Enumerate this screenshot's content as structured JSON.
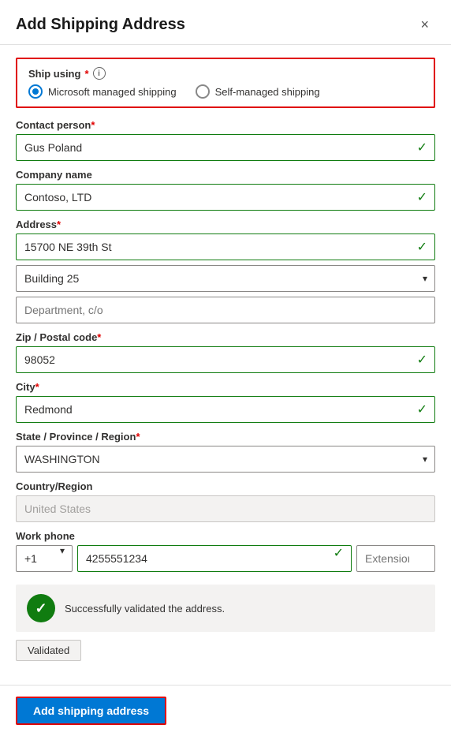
{
  "modal": {
    "title": "Add Shipping Address",
    "close_label": "×"
  },
  "ship_using": {
    "label": "Ship using",
    "required": "*",
    "info": "i",
    "options": [
      {
        "id": "microsoft",
        "label": "Microsoft managed shipping",
        "selected": true
      },
      {
        "id": "self",
        "label": "Self-managed shipping",
        "selected": false
      }
    ]
  },
  "fields": {
    "contact_person": {
      "label": "Contact person",
      "required": "*",
      "value": "Gus Poland",
      "validated": true
    },
    "company_name": {
      "label": "Company name",
      "required": "",
      "value": "Contoso, LTD",
      "validated": true
    },
    "address": {
      "label": "Address",
      "required": "*",
      "line1": {
        "value": "15700 NE 39th St",
        "validated": true
      },
      "line2": {
        "value": "Building 25",
        "validated": false
      },
      "line3": {
        "placeholder": "Department, c/o",
        "value": "",
        "validated": false
      }
    },
    "zip": {
      "label": "Zip / Postal code",
      "required": "*",
      "value": "98052",
      "validated": true
    },
    "city": {
      "label": "City",
      "required": "*",
      "value": "Redmond",
      "validated": true
    },
    "state": {
      "label": "State / Province / Region",
      "required": "*",
      "value": "WASHINGTON",
      "validated": false
    },
    "country": {
      "label": "Country/Region",
      "required": "",
      "value": "United States",
      "disabled": true
    },
    "phone": {
      "label": "Work phone",
      "required": "",
      "code": "+1",
      "number": "4255551234",
      "extension_placeholder": "Extension",
      "validated": true
    }
  },
  "success": {
    "message": "Successfully validated the address.",
    "check": "✓"
  },
  "validated_button": "Validated",
  "footer": {
    "add_button": "Add shipping address"
  }
}
